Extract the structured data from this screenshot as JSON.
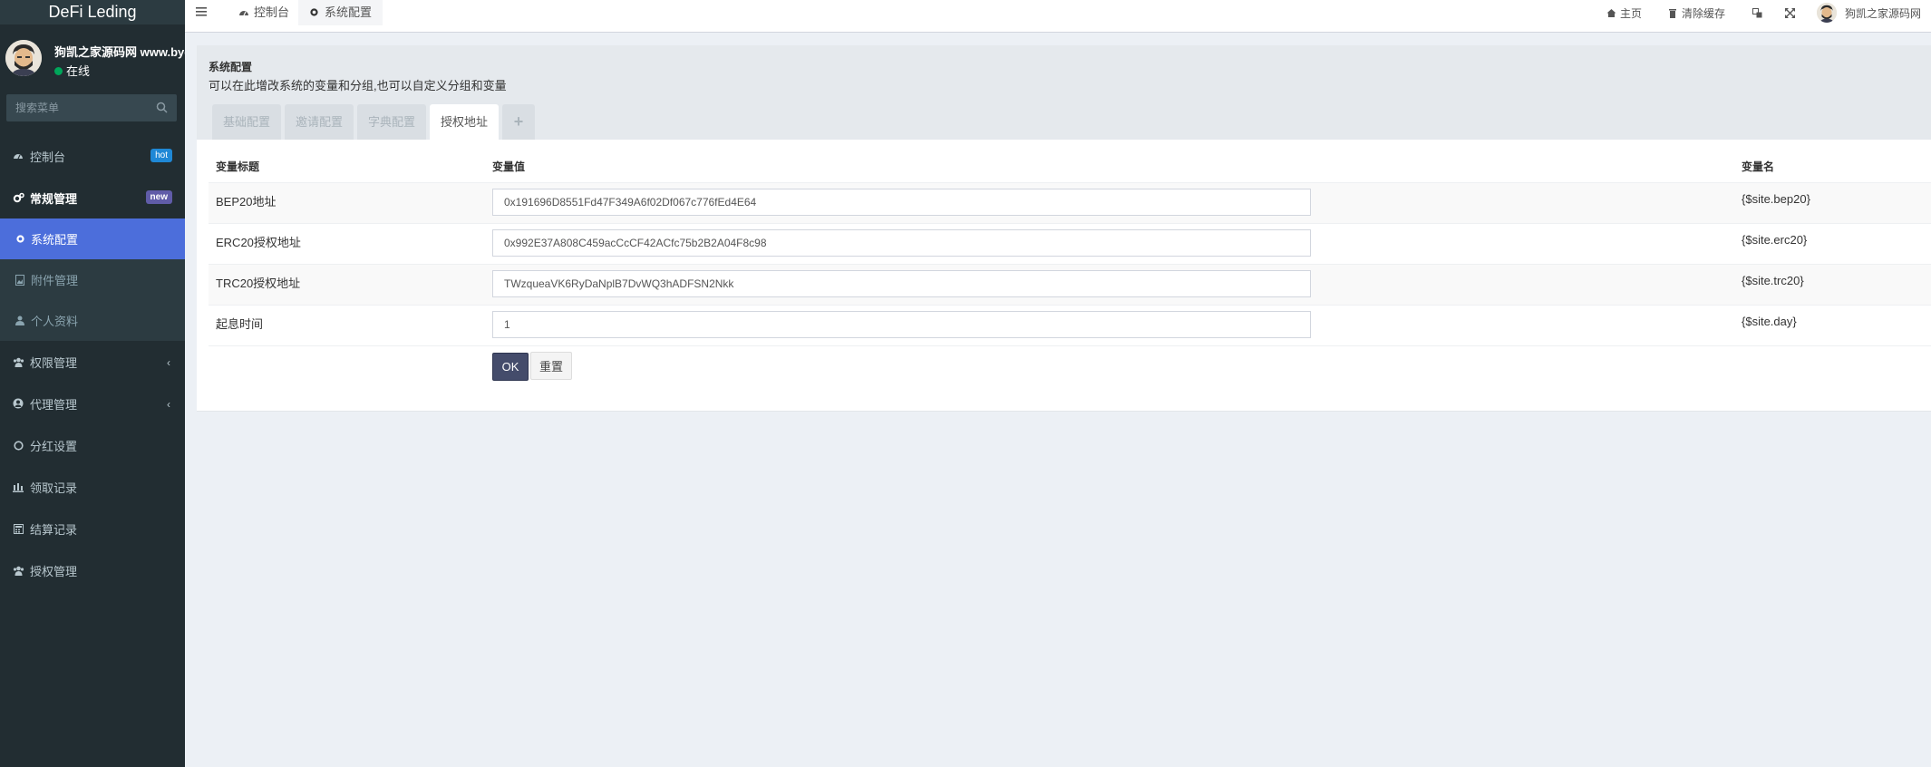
{
  "sidebar": {
    "brand": "DeFi Leding",
    "user_name": "狗凯之家源码网 www.bygo",
    "status": "在线",
    "search_placeholder": "搜索菜单",
    "items": [
      {
        "label": "控制台",
        "badge": "hot"
      },
      {
        "label": "常规管理",
        "badge": "new"
      },
      {
        "label": "系统配置"
      },
      {
        "label": "附件管理"
      },
      {
        "label": "个人资料"
      },
      {
        "label": "权限管理"
      },
      {
        "label": "代理管理"
      },
      {
        "label": "分红设置"
      },
      {
        "label": "领取记录"
      },
      {
        "label": "结算记录"
      },
      {
        "label": "授权管理"
      }
    ]
  },
  "navbar": {
    "tabs": [
      "控制台",
      "系统配置"
    ],
    "home": "主页",
    "clear_cache": "清除缓存",
    "user": "狗凯之家源码网"
  },
  "panel": {
    "title": "系统配置",
    "description": "可以在此增改系统的变量和分组,也可以自定义分组和变量",
    "tabs": [
      "基础配置",
      "邀请配置",
      "字典配置",
      "授权地址",
      "+"
    ]
  },
  "table": {
    "headers": [
      "变量标题",
      "变量值",
      "变量名"
    ],
    "rows": [
      {
        "title": "BEP20地址",
        "value": "0x191696D8551Fd47F349A6f02Df067c776fEd4E64",
        "name": "{$site.bep20}"
      },
      {
        "title": "ERC20授权地址",
        "value": "0x992E37A808C459acCcCF42ACfc75b2B2A04F8c98",
        "name": "{$site.erc20}"
      },
      {
        "title": "TRC20授权地址",
        "value": "TWzqueaVK6RyDaNplB7DvWQ3hADFSN2Nkk",
        "name": "{$site.trc20}"
      },
      {
        "title": "起息时间",
        "value": "1",
        "name": "{$site.day}"
      }
    ],
    "ok_label": "OK",
    "reset_label": "重置"
  }
}
